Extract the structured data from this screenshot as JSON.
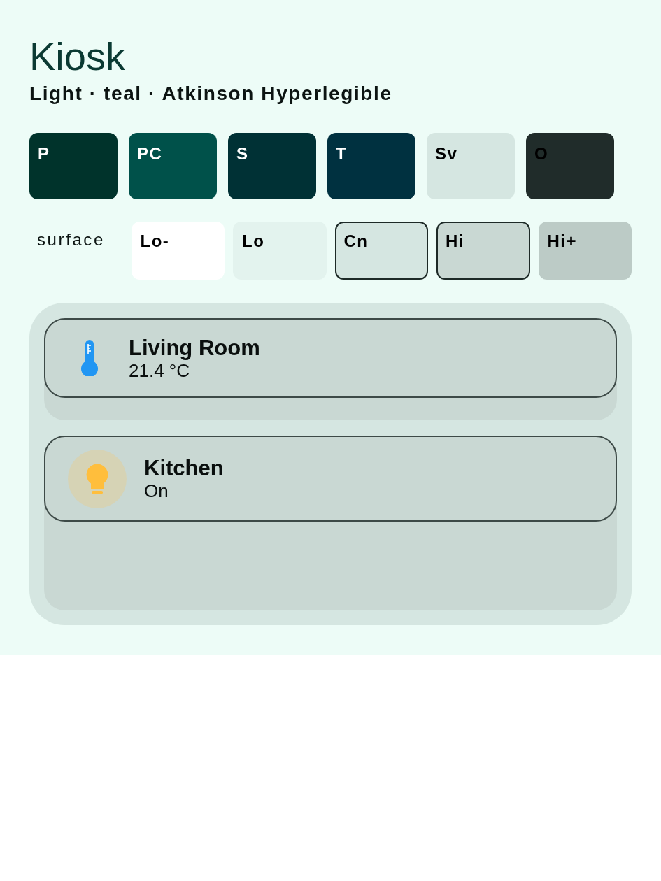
{
  "header": {
    "title": "Kiosk",
    "subtitle": "Light · teal · Atkinson Hyperlegible"
  },
  "palette": [
    {
      "label": "P",
      "color": "#00332b",
      "light_label": true
    },
    {
      "label": "PC",
      "color": "#00514a",
      "light_label": true
    },
    {
      "label": "S",
      "color": "#003135",
      "light_label": true
    },
    {
      "label": "T",
      "color": "#003140",
      "light_label": true
    },
    {
      "label": "Sv",
      "color": "#d5e6e1",
      "light_label": false
    },
    {
      "label": "O",
      "color": "#202c2a",
      "light_label": false
    }
  ],
  "surfaces": {
    "label": "surface",
    "swatches": [
      {
        "label": "Lo-",
        "color": "#ffffff",
        "outlined": false
      },
      {
        "label": "Lo",
        "color": "#e3f3ee",
        "outlined": false
      },
      {
        "label": "Cn",
        "color": "#d5e6e1",
        "outlined": true
      },
      {
        "label": "Hi",
        "color": "#c9d8d3",
        "outlined": true
      },
      {
        "label": "Hi+",
        "color": "#bccbc6",
        "outlined": false
      }
    ]
  },
  "devices": [
    {
      "kind": "sensor",
      "name": "Living Room",
      "reading": "21.4 °C"
    },
    {
      "kind": "light",
      "name": "Kitchen",
      "reading": "On",
      "on": true
    }
  ]
}
